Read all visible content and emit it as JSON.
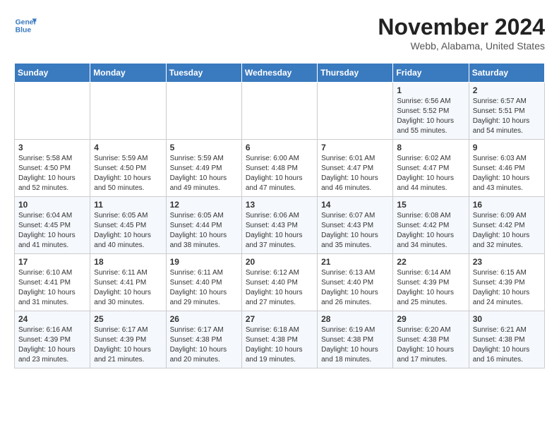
{
  "header": {
    "logo_line1": "General",
    "logo_line2": "Blue",
    "month": "November 2024",
    "location": "Webb, Alabama, United States"
  },
  "days_of_week": [
    "Sunday",
    "Monday",
    "Tuesday",
    "Wednesday",
    "Thursday",
    "Friday",
    "Saturday"
  ],
  "weeks": [
    [
      {
        "day": "",
        "info": ""
      },
      {
        "day": "",
        "info": ""
      },
      {
        "day": "",
        "info": ""
      },
      {
        "day": "",
        "info": ""
      },
      {
        "day": "",
        "info": ""
      },
      {
        "day": "1",
        "info": "Sunrise: 6:56 AM\nSunset: 5:52 PM\nDaylight: 10 hours\nand 55 minutes."
      },
      {
        "day": "2",
        "info": "Sunrise: 6:57 AM\nSunset: 5:51 PM\nDaylight: 10 hours\nand 54 minutes."
      }
    ],
    [
      {
        "day": "3",
        "info": "Sunrise: 5:58 AM\nSunset: 4:50 PM\nDaylight: 10 hours\nand 52 minutes."
      },
      {
        "day": "4",
        "info": "Sunrise: 5:59 AM\nSunset: 4:50 PM\nDaylight: 10 hours\nand 50 minutes."
      },
      {
        "day": "5",
        "info": "Sunrise: 5:59 AM\nSunset: 4:49 PM\nDaylight: 10 hours\nand 49 minutes."
      },
      {
        "day": "6",
        "info": "Sunrise: 6:00 AM\nSunset: 4:48 PM\nDaylight: 10 hours\nand 47 minutes."
      },
      {
        "day": "7",
        "info": "Sunrise: 6:01 AM\nSunset: 4:47 PM\nDaylight: 10 hours\nand 46 minutes."
      },
      {
        "day": "8",
        "info": "Sunrise: 6:02 AM\nSunset: 4:47 PM\nDaylight: 10 hours\nand 44 minutes."
      },
      {
        "day": "9",
        "info": "Sunrise: 6:03 AM\nSunset: 4:46 PM\nDaylight: 10 hours\nand 43 minutes."
      }
    ],
    [
      {
        "day": "10",
        "info": "Sunrise: 6:04 AM\nSunset: 4:45 PM\nDaylight: 10 hours\nand 41 minutes."
      },
      {
        "day": "11",
        "info": "Sunrise: 6:05 AM\nSunset: 4:45 PM\nDaylight: 10 hours\nand 40 minutes."
      },
      {
        "day": "12",
        "info": "Sunrise: 6:05 AM\nSunset: 4:44 PM\nDaylight: 10 hours\nand 38 minutes."
      },
      {
        "day": "13",
        "info": "Sunrise: 6:06 AM\nSunset: 4:43 PM\nDaylight: 10 hours\nand 37 minutes."
      },
      {
        "day": "14",
        "info": "Sunrise: 6:07 AM\nSunset: 4:43 PM\nDaylight: 10 hours\nand 35 minutes."
      },
      {
        "day": "15",
        "info": "Sunrise: 6:08 AM\nSunset: 4:42 PM\nDaylight: 10 hours\nand 34 minutes."
      },
      {
        "day": "16",
        "info": "Sunrise: 6:09 AM\nSunset: 4:42 PM\nDaylight: 10 hours\nand 32 minutes."
      }
    ],
    [
      {
        "day": "17",
        "info": "Sunrise: 6:10 AM\nSunset: 4:41 PM\nDaylight: 10 hours\nand 31 minutes."
      },
      {
        "day": "18",
        "info": "Sunrise: 6:11 AM\nSunset: 4:41 PM\nDaylight: 10 hours\nand 30 minutes."
      },
      {
        "day": "19",
        "info": "Sunrise: 6:11 AM\nSunset: 4:40 PM\nDaylight: 10 hours\nand 29 minutes."
      },
      {
        "day": "20",
        "info": "Sunrise: 6:12 AM\nSunset: 4:40 PM\nDaylight: 10 hours\nand 27 minutes."
      },
      {
        "day": "21",
        "info": "Sunrise: 6:13 AM\nSunset: 4:40 PM\nDaylight: 10 hours\nand 26 minutes."
      },
      {
        "day": "22",
        "info": "Sunrise: 6:14 AM\nSunset: 4:39 PM\nDaylight: 10 hours\nand 25 minutes."
      },
      {
        "day": "23",
        "info": "Sunrise: 6:15 AM\nSunset: 4:39 PM\nDaylight: 10 hours\nand 24 minutes."
      }
    ],
    [
      {
        "day": "24",
        "info": "Sunrise: 6:16 AM\nSunset: 4:39 PM\nDaylight: 10 hours\nand 23 minutes."
      },
      {
        "day": "25",
        "info": "Sunrise: 6:17 AM\nSunset: 4:39 PM\nDaylight: 10 hours\nand 21 minutes."
      },
      {
        "day": "26",
        "info": "Sunrise: 6:17 AM\nSunset: 4:38 PM\nDaylight: 10 hours\nand 20 minutes."
      },
      {
        "day": "27",
        "info": "Sunrise: 6:18 AM\nSunset: 4:38 PM\nDaylight: 10 hours\nand 19 minutes."
      },
      {
        "day": "28",
        "info": "Sunrise: 6:19 AM\nSunset: 4:38 PM\nDaylight: 10 hours\nand 18 minutes."
      },
      {
        "day": "29",
        "info": "Sunrise: 6:20 AM\nSunset: 4:38 PM\nDaylight: 10 hours\nand 17 minutes."
      },
      {
        "day": "30",
        "info": "Sunrise: 6:21 AM\nSunset: 4:38 PM\nDaylight: 10 hours\nand 16 minutes."
      }
    ]
  ]
}
